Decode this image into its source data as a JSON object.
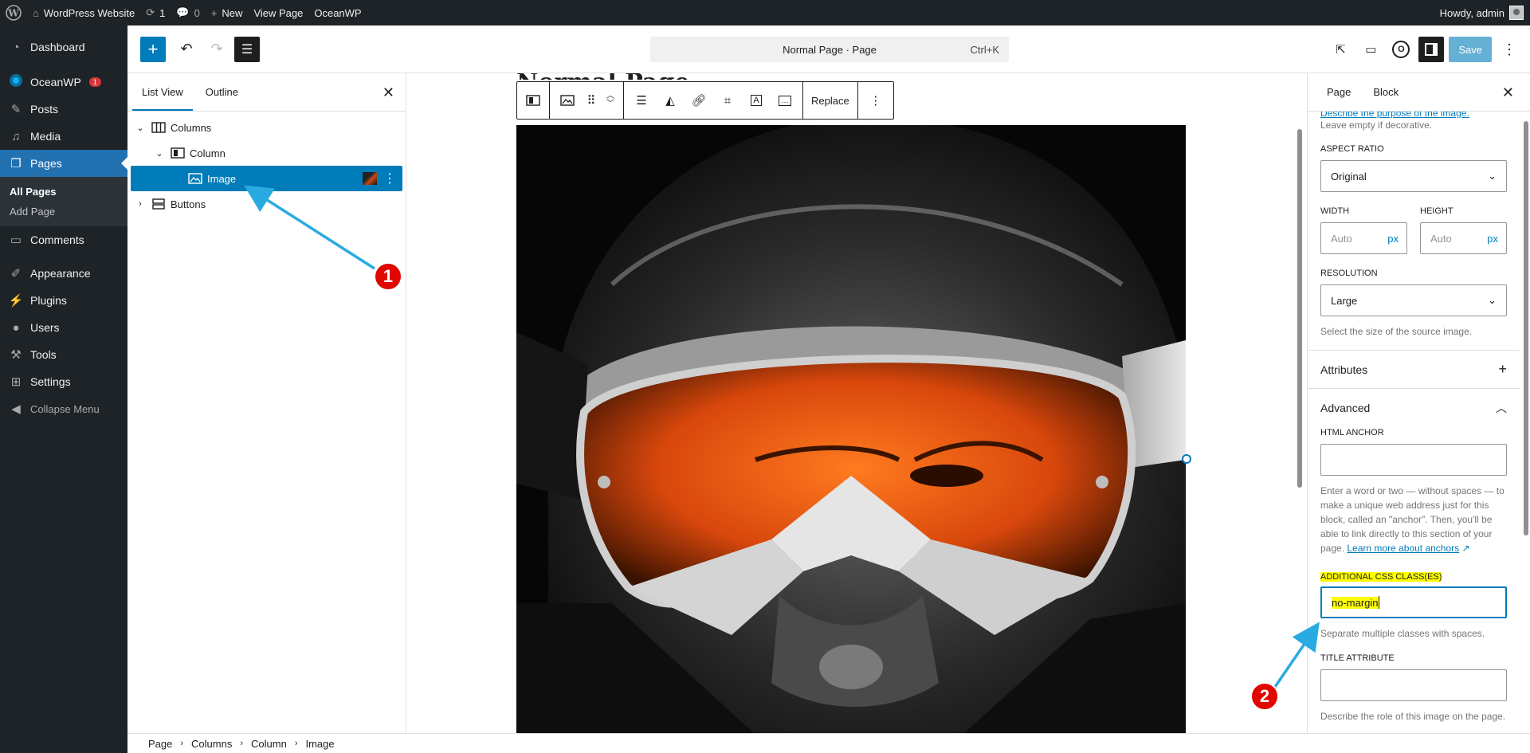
{
  "admin_bar": {
    "site_name": "WordPress Website",
    "updates_count": "1",
    "comments_count": "0",
    "new_label": "New",
    "view_page_label": "View Page",
    "theme_label": "OceanWP",
    "howdy": "Howdy, admin"
  },
  "admin_menu": {
    "dashboard": "Dashboard",
    "oceanwp": "OceanWP",
    "oceanwp_badge": "1",
    "posts": "Posts",
    "media": "Media",
    "pages": "Pages",
    "all_pages": "All Pages",
    "add_page": "Add Page",
    "comments": "Comments",
    "appearance": "Appearance",
    "plugins": "Plugins",
    "users": "Users",
    "tools": "Tools",
    "settings": "Settings",
    "collapse": "Collapse Menu"
  },
  "toolbar": {
    "command_title": "Normal Page · Page",
    "command_shortcut": "Ctrl+K",
    "save_label": "Save"
  },
  "list_view": {
    "tab_list": "List View",
    "tab_outline": "Outline",
    "items": {
      "columns": "Columns",
      "column": "Column",
      "image": "Image",
      "buttons": "Buttons"
    }
  },
  "canvas": {
    "page_heading": "Normal Page",
    "replace_label": "Replace"
  },
  "sidebar": {
    "tab_page": "Page",
    "tab_block": "Block",
    "alt_help_partial": "Describe the purpose of the image.",
    "alt_help_rest": "Leave empty if decorative.",
    "aspect_ratio_label": "ASPECT RATIO",
    "aspect_ratio_value": "Original",
    "width_label": "WIDTH",
    "height_label": "HEIGHT",
    "width_placeholder": "Auto",
    "height_placeholder": "Auto",
    "unit": "px",
    "resolution_label": "RESOLUTION",
    "resolution_value": "Large",
    "resolution_help": "Select the size of the source image.",
    "attributes_label": "Attributes",
    "advanced_label": "Advanced",
    "html_anchor_label": "HTML ANCHOR",
    "html_anchor_help": "Enter a word or two — without spaces — to make a unique web address just for this block, called an \"anchor\". Then, you'll be able to link directly to this section of your page.",
    "anchors_link": "Learn more about anchors",
    "css_class_label": "ADDITIONAL CSS CLASS(ES)",
    "css_class_value": "no-margin",
    "css_class_help": "Separate multiple classes with spaces.",
    "title_attr_label": "TITLE ATTRIBUTE",
    "title_attr_help": "Describe the role of this image on the page."
  },
  "breadcrumbs": [
    "Page",
    "Columns",
    "Column",
    "Image"
  ],
  "callouts": [
    "1",
    "2"
  ],
  "colors": {
    "accent": "#007cba",
    "admin_bg": "#1d2327",
    "callout": "#e10600",
    "arrow": "#29abe2",
    "highlight": "#ffff00"
  }
}
